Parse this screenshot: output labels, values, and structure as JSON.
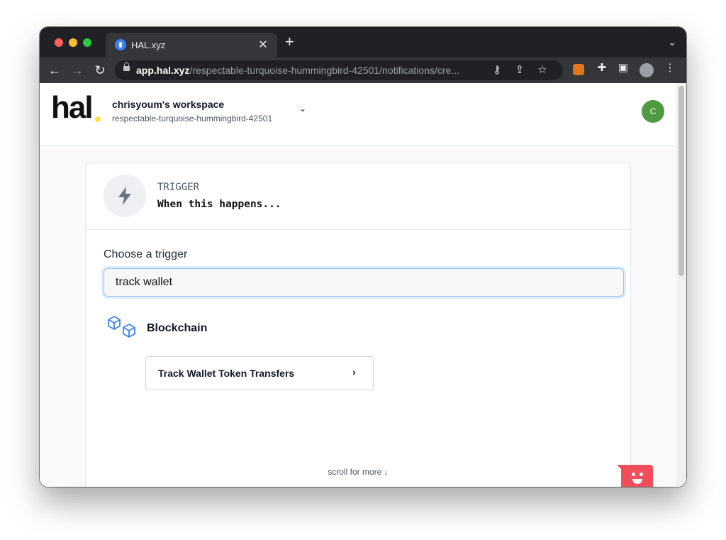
{
  "browser": {
    "tab_title": "HAL.xyz",
    "tab_close": "✕",
    "new_tab": "+",
    "tab_dropdown": "⌄",
    "url_host": "app.hal.xyz",
    "url_path": "/respectable-turquoise-hummingbird-42501/notifications/cre..."
  },
  "header": {
    "logo": "hal",
    "workspace_name": "chrisyoum's workspace",
    "workspace_slug": "respectable-turquoise-hummingbird-42501",
    "user_initial": "C"
  },
  "trigger": {
    "label": "TRIGGER",
    "subtitle": "When this happens...",
    "choose_label": "Choose a trigger",
    "search_value": "track wallet",
    "category": "Blockchain",
    "option": "Track Wallet Token Transfers",
    "scroll_hint": "scroll for more  ↓"
  },
  "colors": {
    "accent_blue": "#3b82f6",
    "avatar_green": "#4e9a41",
    "chat_red": "#ef4e5a",
    "logo_dot": "#fde047"
  }
}
